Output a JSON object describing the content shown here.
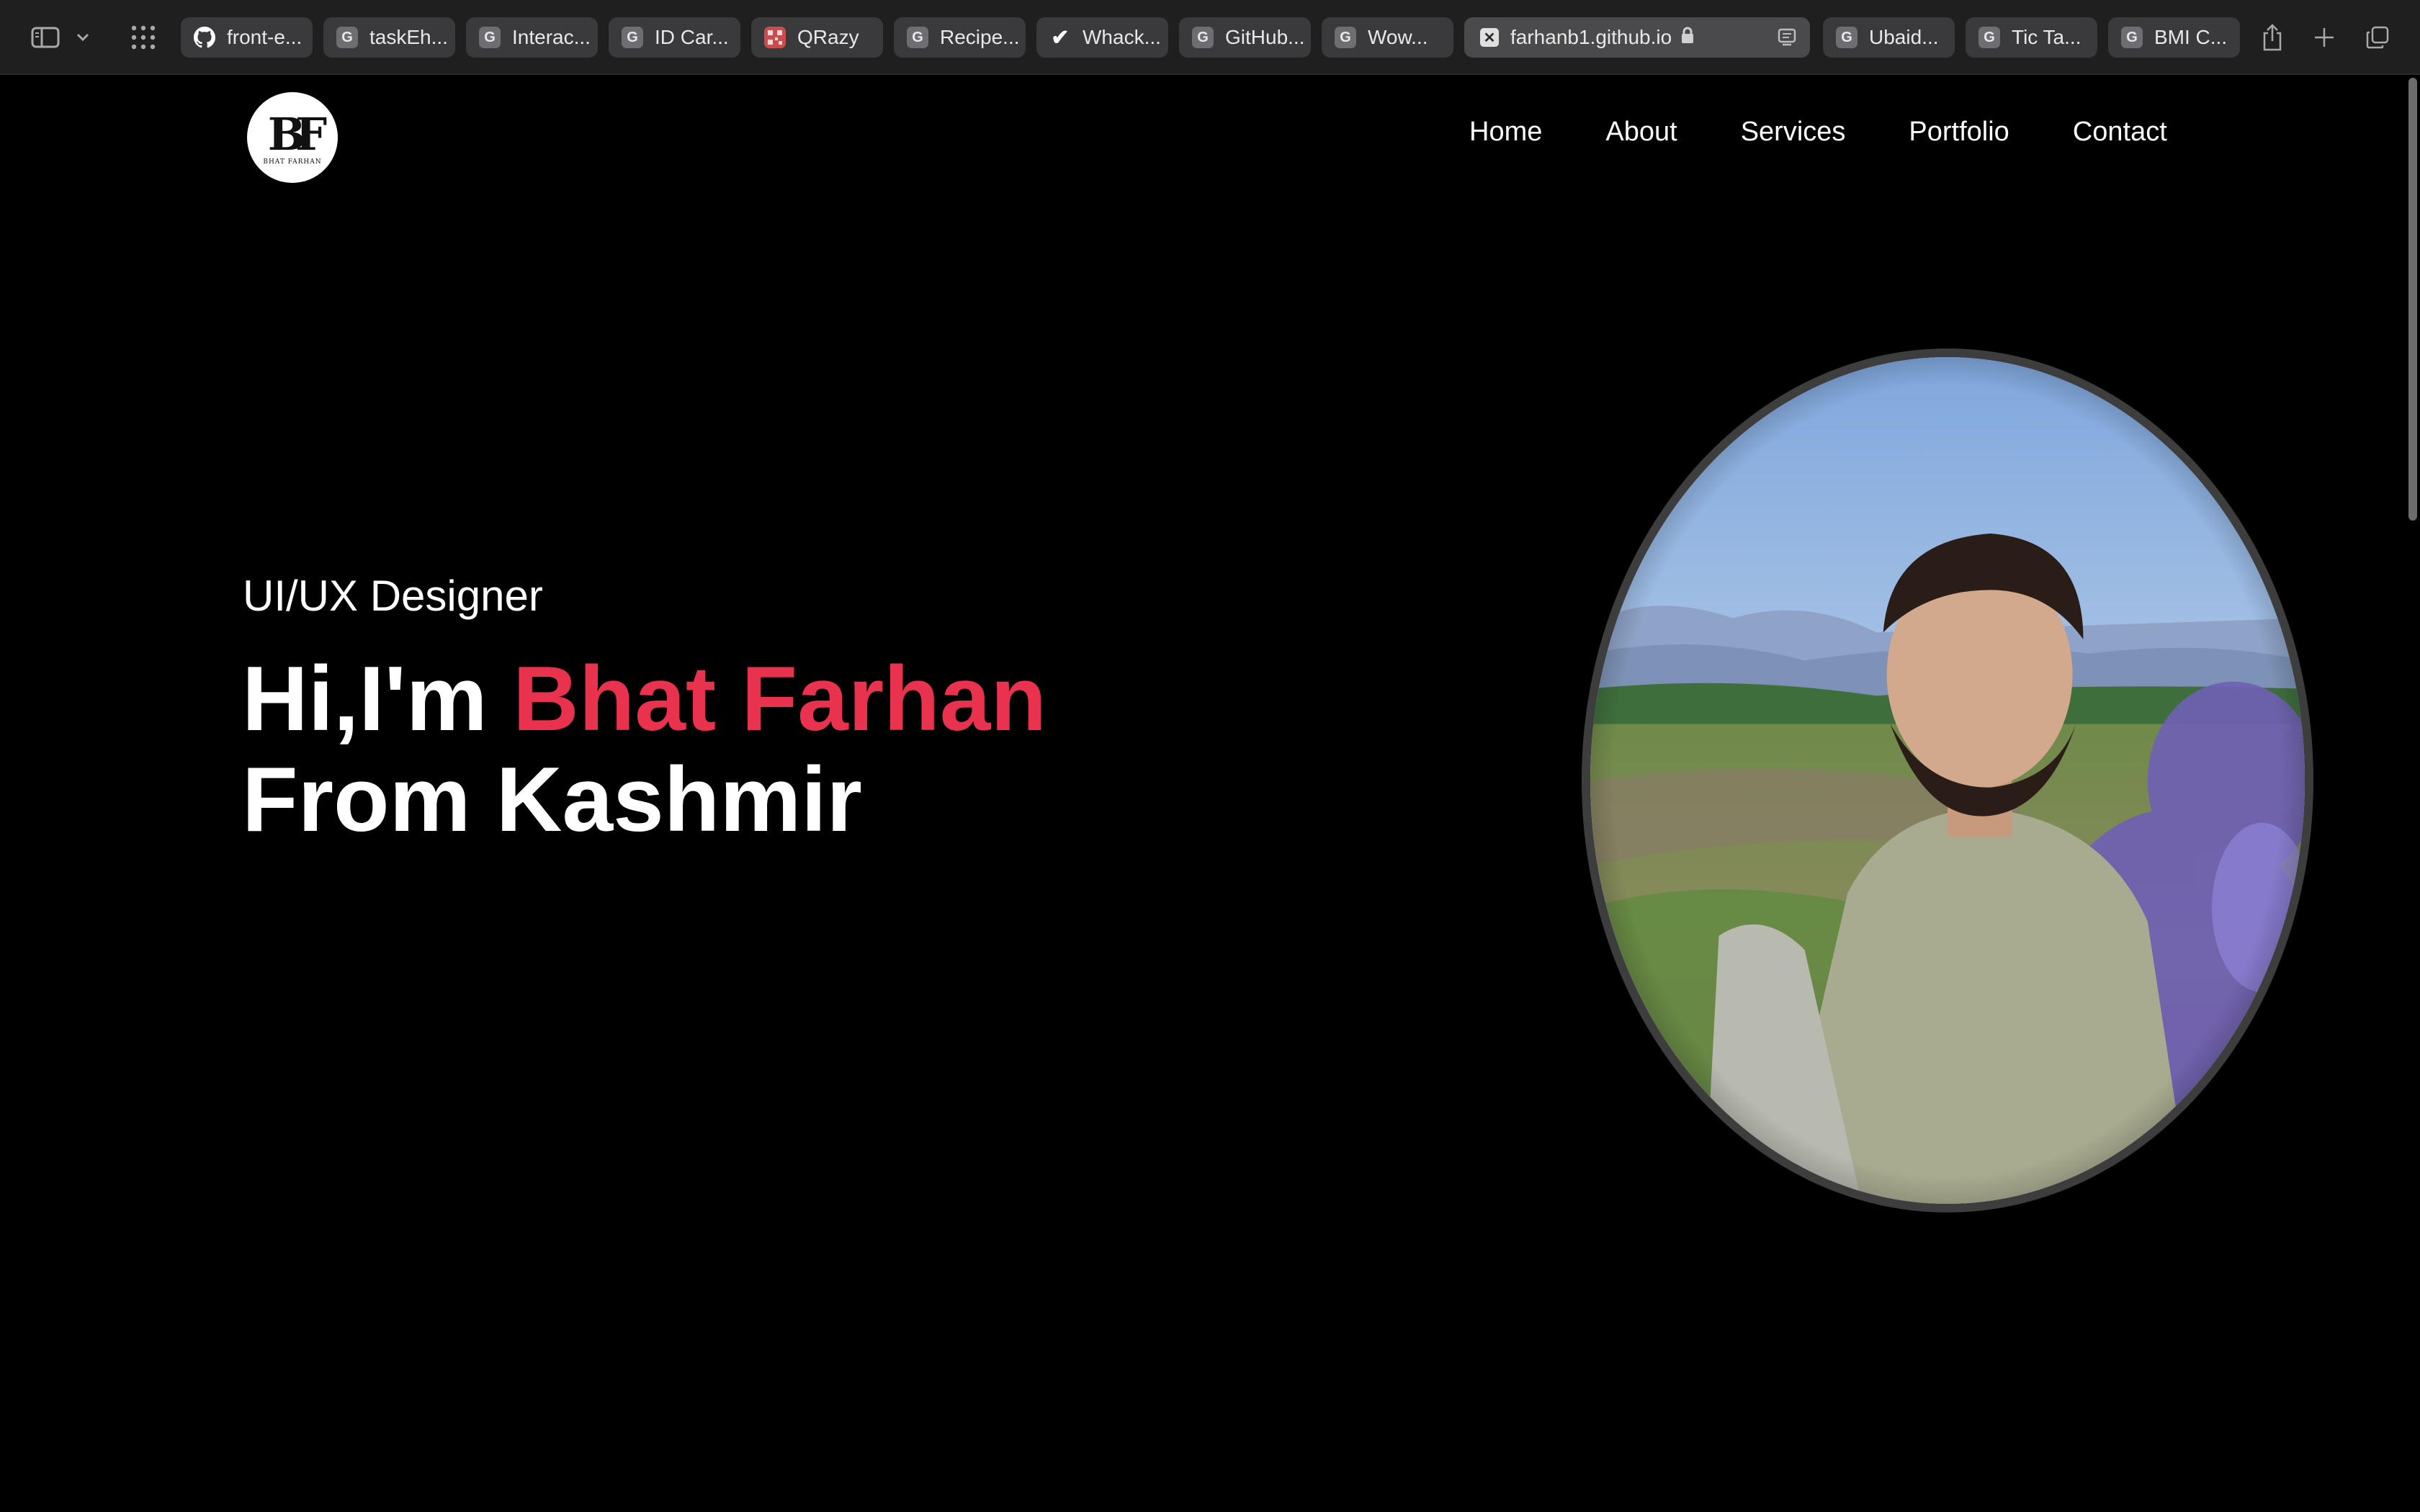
{
  "browser": {
    "tabs": [
      {
        "label": "front-e...",
        "icon": "github-icon"
      },
      {
        "label": "taskEh...",
        "icon": "G"
      },
      {
        "label": "Interac...",
        "icon": "G"
      },
      {
        "label": "ID Car...",
        "icon": "G"
      },
      {
        "label": "QRazy",
        "icon": "qr-icon"
      },
      {
        "label": "Recipe...",
        "icon": "G"
      },
      {
        "label": "Whack...",
        "icon": "check-icon"
      },
      {
        "label": "GitHub...",
        "icon": "G"
      },
      {
        "label": "Wow...",
        "icon": "G"
      },
      {
        "label": "farhanb1.github.io",
        "icon": "close-icon",
        "active": true
      },
      {
        "label": "Ubaid...",
        "icon": "G"
      },
      {
        "label": "Tic Ta...",
        "icon": "G"
      },
      {
        "label": "BMI C...",
        "icon": "G"
      }
    ]
  },
  "site": {
    "logo": {
      "monogram": "BF",
      "subtitle": "BHAT FARHAN"
    },
    "nav": [
      "Home",
      "About",
      "Services",
      "Portfolio",
      "Contact"
    ],
    "hero": {
      "role": "UI/UX Designer",
      "greeting": "Hi,I'm",
      "name": "Bhat Farhan",
      "line2": "From Kashmir"
    },
    "accent_color": "#e8324e"
  }
}
